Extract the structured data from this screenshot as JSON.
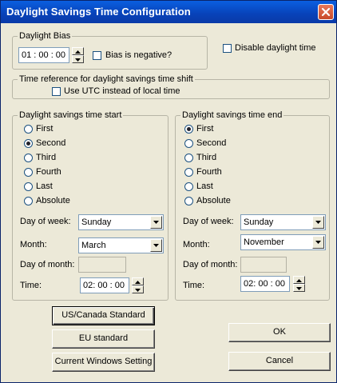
{
  "window": {
    "title": "Daylight Savings Time Configuration"
  },
  "icons": {
    "close": "close-icon",
    "dropdown": "chevron-down-icon",
    "spin_up": "spin-up-icon",
    "spin_down": "spin-down-icon"
  },
  "bias": {
    "legend": "Daylight Bias",
    "value": "01 : 00 : 00",
    "negative_label": "Bias is negative?",
    "negative_checked": false
  },
  "disable_daylight": {
    "label": "Disable daylight time",
    "checked": false
  },
  "time_reference": {
    "legend": "Time reference for daylight savings time shift",
    "utc_label": "Use UTC instead of local time",
    "utc_checked": false
  },
  "start": {
    "legend": "Daylight savings time start",
    "options": [
      "First",
      "Second",
      "Third",
      "Fourth",
      "Last",
      "Absolute"
    ],
    "selected": "Second",
    "day_of_week_label": "Day of week:",
    "day_of_week": "Sunday",
    "month_label": "Month:",
    "month": "March",
    "day_of_month_label": "Day of month:",
    "day_of_month": "",
    "time_label": "Time:",
    "time": "02: 00 : 00"
  },
  "end": {
    "legend": "Daylight savings time end",
    "options": [
      "First",
      "Second",
      "Third",
      "Fourth",
      "Last",
      "Absolute"
    ],
    "selected": "First",
    "day_of_week_label": "Day of week:",
    "day_of_week": "Sunday",
    "month_label": "Month:",
    "month": "November",
    "day_of_month_label": "Day of month:",
    "day_of_month": "",
    "time_label": "Time:",
    "time": "02: 00 : 00"
  },
  "buttons": {
    "us_canada": "US/Canada Standard",
    "eu": "EU standard",
    "current_windows": "Current Windows Setting",
    "ok": "OK",
    "cancel": "Cancel"
  }
}
